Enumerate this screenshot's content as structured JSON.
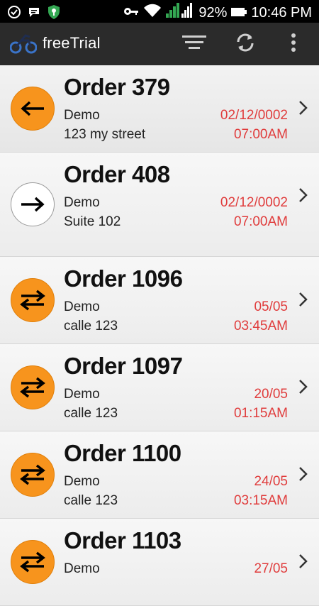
{
  "status_bar": {
    "battery": "92%",
    "time": "10:46 PM",
    "icons": [
      "check-circle-icon",
      "chat-bubble-icon",
      "shield-icon",
      "key-icon",
      "wifi-icon",
      "signal-icon",
      "battery-icon"
    ]
  },
  "app_bar": {
    "title": "freeTrial",
    "icons": [
      "sort-icon",
      "refresh-icon",
      "more-vert-icon"
    ]
  },
  "colors": {
    "accent": "#f7941d",
    "date_text": "#e03c3c",
    "app_bar": "#2b2b2b"
  },
  "orders": [
    {
      "title": "Order 379",
      "name": "Demo",
      "address": "123 my street",
      "date": "02/12/0002",
      "time": "07:00AM",
      "icon": "arrow-left-icon"
    },
    {
      "title": "Order 408",
      "name": "Demo",
      "address": "Suite 102",
      "date": "02/12/0002",
      "time": "07:00AM",
      "icon": "arrow-right-icon"
    },
    {
      "title": "Order 1096",
      "name": "Demo",
      "address": "calle 123",
      "date": "05/05",
      "time": "03:45AM",
      "icon": "swap-arrows-icon"
    },
    {
      "title": "Order 1097",
      "name": "Demo",
      "address": "calle 123",
      "date": "20/05",
      "time": "01:15AM",
      "icon": "swap-arrows-icon"
    },
    {
      "title": "Order 1100",
      "name": "Demo",
      "address": "calle 123",
      "date": "24/05",
      "time": "03:15AM",
      "icon": "swap-arrows-icon"
    },
    {
      "title": "Order 1103",
      "name": "Demo",
      "address": "",
      "date": "27/05",
      "time": "",
      "icon": "swap-arrows-icon"
    }
  ]
}
